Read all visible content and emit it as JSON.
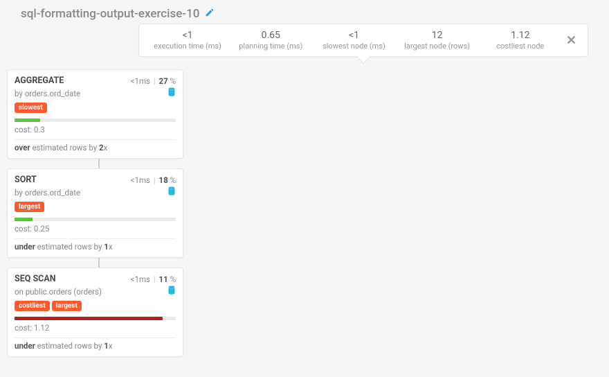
{
  "title": "sql-formatting-output-exercise-10",
  "stats": {
    "exec_time": {
      "value": "<1",
      "label": "execution time (ms)"
    },
    "plan_time": {
      "value": "0.65",
      "label": "planning time (ms)"
    },
    "slowest": {
      "value": "<1",
      "label": "slowest node (ms)"
    },
    "largest": {
      "value": "12",
      "label": "largest node (rows)"
    },
    "costliest": {
      "value": "1.12",
      "label": "costliest node"
    }
  },
  "nodes": [
    {
      "name": "AGGREGATE",
      "time": "<1ms",
      "percent": "27",
      "sub_prefix": "by ",
      "sub_value": "orders.ord_date",
      "tags": [
        "slowest"
      ],
      "bar_class": "bar-green",
      "bar_width": "16%",
      "cost_label": "cost: ",
      "cost_value": "0.3",
      "est_strong1": "over",
      "est_mid": " estimated rows by ",
      "est_strong2": "2",
      "est_suffix": "x"
    },
    {
      "name": "SORT",
      "time": "<1ms",
      "percent": "18",
      "sub_prefix": "by ",
      "sub_value": "orders.ord_date",
      "tags": [
        "largest"
      ],
      "bar_class": "bar-green",
      "bar_width": "11%",
      "cost_label": "cost: ",
      "cost_value": "0.25",
      "est_strong1": "under",
      "est_mid": " estimated rows by ",
      "est_strong2": "1",
      "est_suffix": "x"
    },
    {
      "name": "SEQ SCAN",
      "time": "<1ms",
      "percent": "11",
      "sub_prefix": "on ",
      "sub_value": "public.orders (orders)",
      "tags": [
        "costliest",
        "largest"
      ],
      "bar_class": "bar-red",
      "bar_width": "92%",
      "cost_label": "cost: ",
      "cost_value": "1.12",
      "est_strong1": "under",
      "est_mid": " estimated rows by ",
      "est_strong2": "1",
      "est_suffix": "x"
    }
  ]
}
